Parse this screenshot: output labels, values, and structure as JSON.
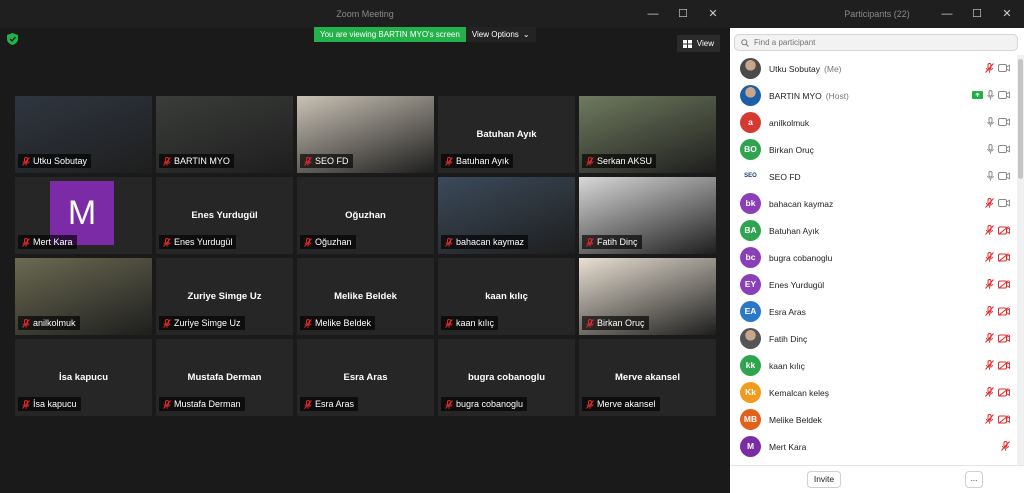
{
  "zoom": {
    "title": "Zoom Meeting",
    "banner": "You are viewing BARTIN MYO's screen",
    "view_options": "View Options",
    "view_button": "View"
  },
  "tiles": [
    {
      "label": "Utku Sobutay",
      "center_name": "",
      "type": "video",
      "bg": "#2f3640"
    },
    {
      "label": "BARTIN MYO",
      "center_name": "",
      "type": "video",
      "bg": "#3a3d3a"
    },
    {
      "label": "SEO FD",
      "center_name": "",
      "type": "video",
      "bg": "#c9c2b5"
    },
    {
      "label": "Batuhan Ayık",
      "center_name": "Batuhan Ayık",
      "type": "name"
    },
    {
      "label": "Serkan AKSU",
      "center_name": "",
      "type": "video",
      "bg": "#6f7a5e"
    },
    {
      "label": "Mert Kara",
      "center_name": "",
      "type": "avatar",
      "avatar_letter": "M"
    },
    {
      "label": "Enes Yurdugül",
      "center_name": "Enes Yurdugül",
      "type": "name"
    },
    {
      "label": "Oğuzhan",
      "center_name": "Oğuzhan",
      "type": "name"
    },
    {
      "label": "bahacan kaymaz",
      "center_name": "",
      "type": "video",
      "bg": "#3b4a5a"
    },
    {
      "label": "Fatih Dinç",
      "center_name": "",
      "type": "video",
      "bg": "#d8d8d8"
    },
    {
      "label": "anilkolmuk",
      "center_name": "",
      "type": "video",
      "bg": "#6b6a52",
      "active": true
    },
    {
      "label": "Zuriye Simge Uz",
      "center_name": "Zuriye Simge Uz",
      "type": "name"
    },
    {
      "label": "Melike Beldek",
      "center_name": "Melike Beldek",
      "type": "name"
    },
    {
      "label": "kaan kılıç",
      "center_name": "kaan kılıç",
      "type": "name"
    },
    {
      "label": "Birkan Oruç",
      "center_name": "",
      "type": "video",
      "bg": "#e8e0d2"
    },
    {
      "label": "İsa kapucu",
      "center_name": "İsa kapucu",
      "type": "name"
    },
    {
      "label": "Mustafa Derman",
      "center_name": "Mustafa Derman",
      "type": "name"
    },
    {
      "label": "Esra Aras",
      "center_name": "Esra Aras",
      "type": "name"
    },
    {
      "label": "bugra cobanoglu",
      "center_name": "bugra cobanoglu",
      "type": "name"
    },
    {
      "label": "Merve akansel",
      "center_name": "Merve akansel",
      "type": "name"
    }
  ],
  "panel": {
    "title": "Participants (22)",
    "search_placeholder": "Find a participant",
    "invite": "Invite",
    "more": "..."
  },
  "participants": [
    {
      "name": "Utku Sobutay",
      "role": "(Me)",
      "initials": "",
      "color": "#4a4a4a",
      "photo": true,
      "mic": "muted",
      "video": "on"
    },
    {
      "name": "BARTIN MYO",
      "role": "(Host)",
      "initials": "",
      "color": "#1c5fa8",
      "photo": true,
      "share": true,
      "mic": "on",
      "video": "on"
    },
    {
      "name": "anilkolmuk",
      "role": "",
      "initials": "a",
      "color": "#d43a2f",
      "mic": "on",
      "video": "on"
    },
    {
      "name": "Birkan Oruç",
      "role": "",
      "initials": "BO",
      "color": "#2fa44f",
      "mic": "on",
      "video": "on"
    },
    {
      "name": "SEO FD",
      "role": "",
      "initials": "SEOFD",
      "color": "#ffffff",
      "mic": "on",
      "video": "on"
    },
    {
      "name": "bahacan kaymaz",
      "role": "",
      "initials": "bk",
      "color": "#8a3fb8",
      "mic": "muted",
      "video": "on"
    },
    {
      "name": "Batuhan Ayık",
      "role": "",
      "initials": "BA",
      "color": "#2fa44f",
      "mic": "muted",
      "video": "off"
    },
    {
      "name": "bugra cobanoglu",
      "role": "",
      "initials": "bc",
      "color": "#8a3fb8",
      "mic": "muted",
      "video": "off"
    },
    {
      "name": "Enes Yurdugül",
      "role": "",
      "initials": "EY",
      "color": "#8a3fb8",
      "mic": "muted",
      "video": "off"
    },
    {
      "name": "Esra Aras",
      "role": "",
      "initials": "EA",
      "color": "#2a78c8",
      "mic": "muted",
      "video": "off"
    },
    {
      "name": "Fatih Dinç",
      "role": "",
      "initials": "",
      "color": "#555555",
      "photo": true,
      "mic": "muted",
      "video": "off"
    },
    {
      "name": "kaan kılıç",
      "role": "",
      "initials": "kk",
      "color": "#2fa44f",
      "mic": "muted",
      "video": "off"
    },
    {
      "name": "Kemalcan keleş",
      "role": "",
      "initials": "Kk",
      "color": "#f29a1e",
      "mic": "muted",
      "video": "off"
    },
    {
      "name": "Melike Beldek",
      "role": "",
      "initials": "MB",
      "color": "#e0601c",
      "mic": "muted",
      "video": "off"
    },
    {
      "name": "Mert Kara",
      "role": "",
      "initials": "M",
      "color": "#7b2ba6",
      "mic": "muted",
      "video": "none"
    }
  ],
  "colors": {
    "accent_green": "#23b24a",
    "muted_red": "#e02828",
    "tile_bg": "#262626"
  }
}
